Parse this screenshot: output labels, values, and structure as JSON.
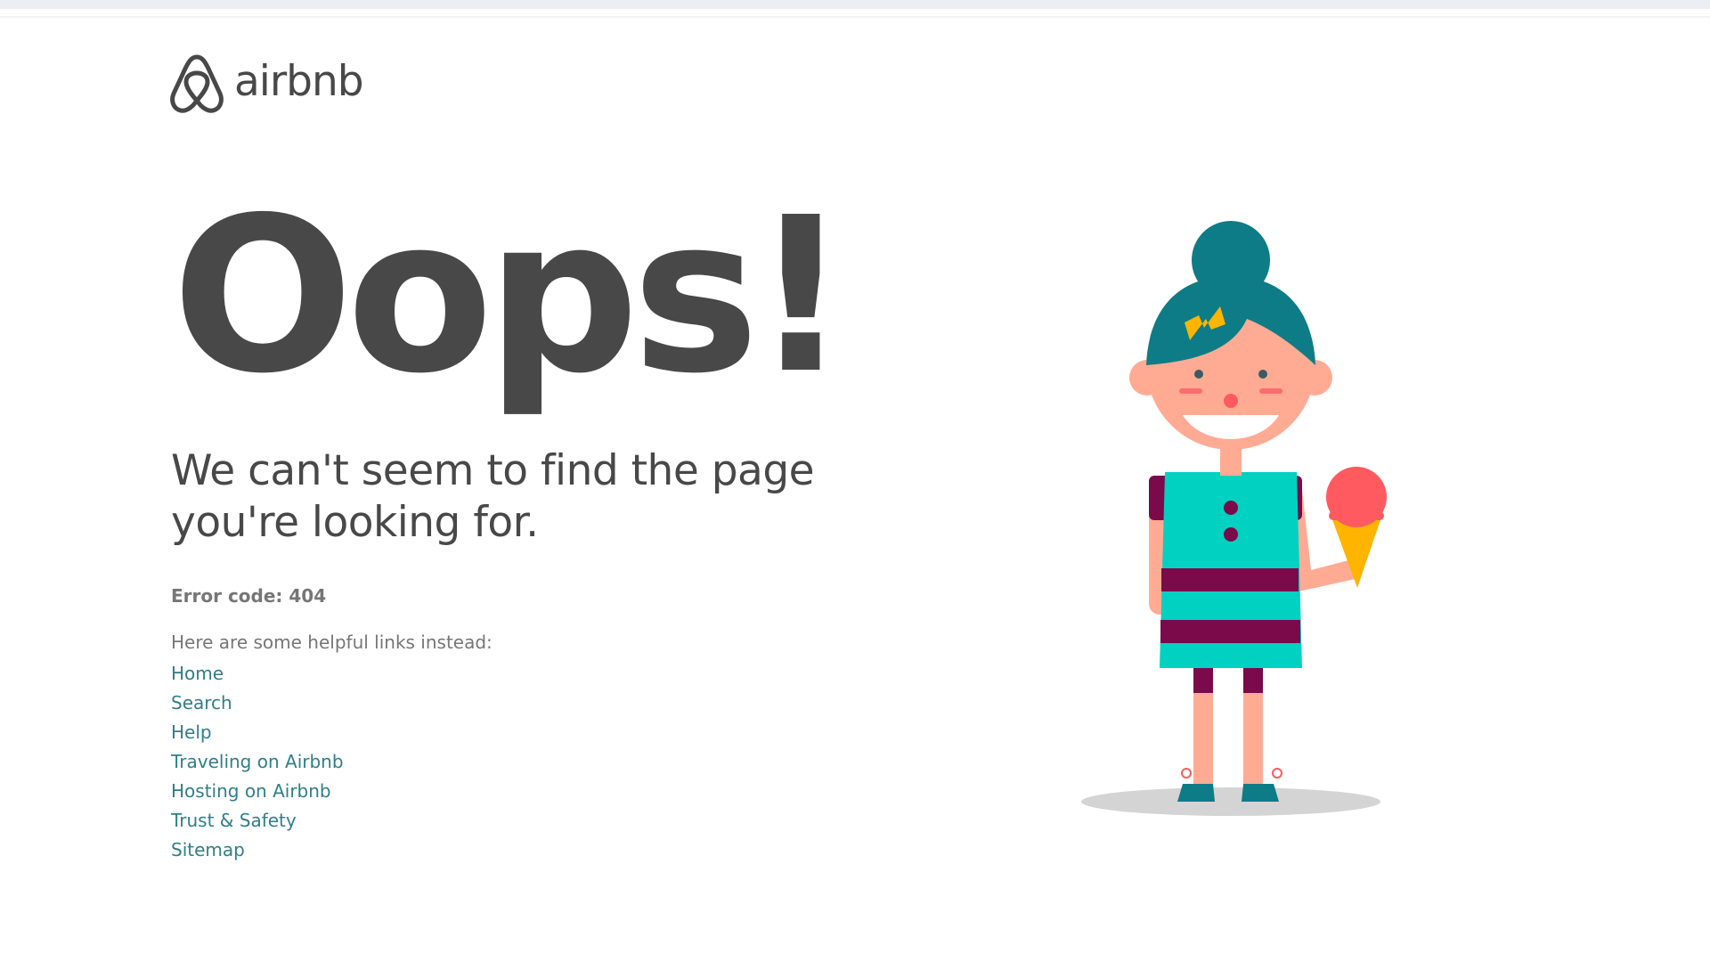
{
  "brand": {
    "name": "airbnb",
    "logo_color": "#484848"
  },
  "main": {
    "headline": "Oops!",
    "subheadline_line1": "We can't seem to find the page",
    "subheadline_line2": "you're looking for.",
    "error_code": "Error code: 404",
    "links_intro": "Here are some helpful links instead:",
    "links": [
      {
        "label": "Home"
      },
      {
        "label": "Search"
      },
      {
        "label": "Help"
      },
      {
        "label": "Traveling on Airbnb"
      },
      {
        "label": "Hosting on Airbnb"
      },
      {
        "label": "Trust & Safety"
      },
      {
        "label": "Sitemap"
      }
    ]
  },
  "colors": {
    "text": "#484848",
    "muted": "#767676",
    "link": "#2f7f8a",
    "hair": "#0e7c86",
    "dress": "#00d1c1",
    "stripe": "#7a0a4a",
    "skin": "#ffb3a0",
    "ice_cream": "#ff5a5f",
    "cone": "#ffb400"
  },
  "illustration": {
    "subject": "girl-holding-ice-cream"
  }
}
